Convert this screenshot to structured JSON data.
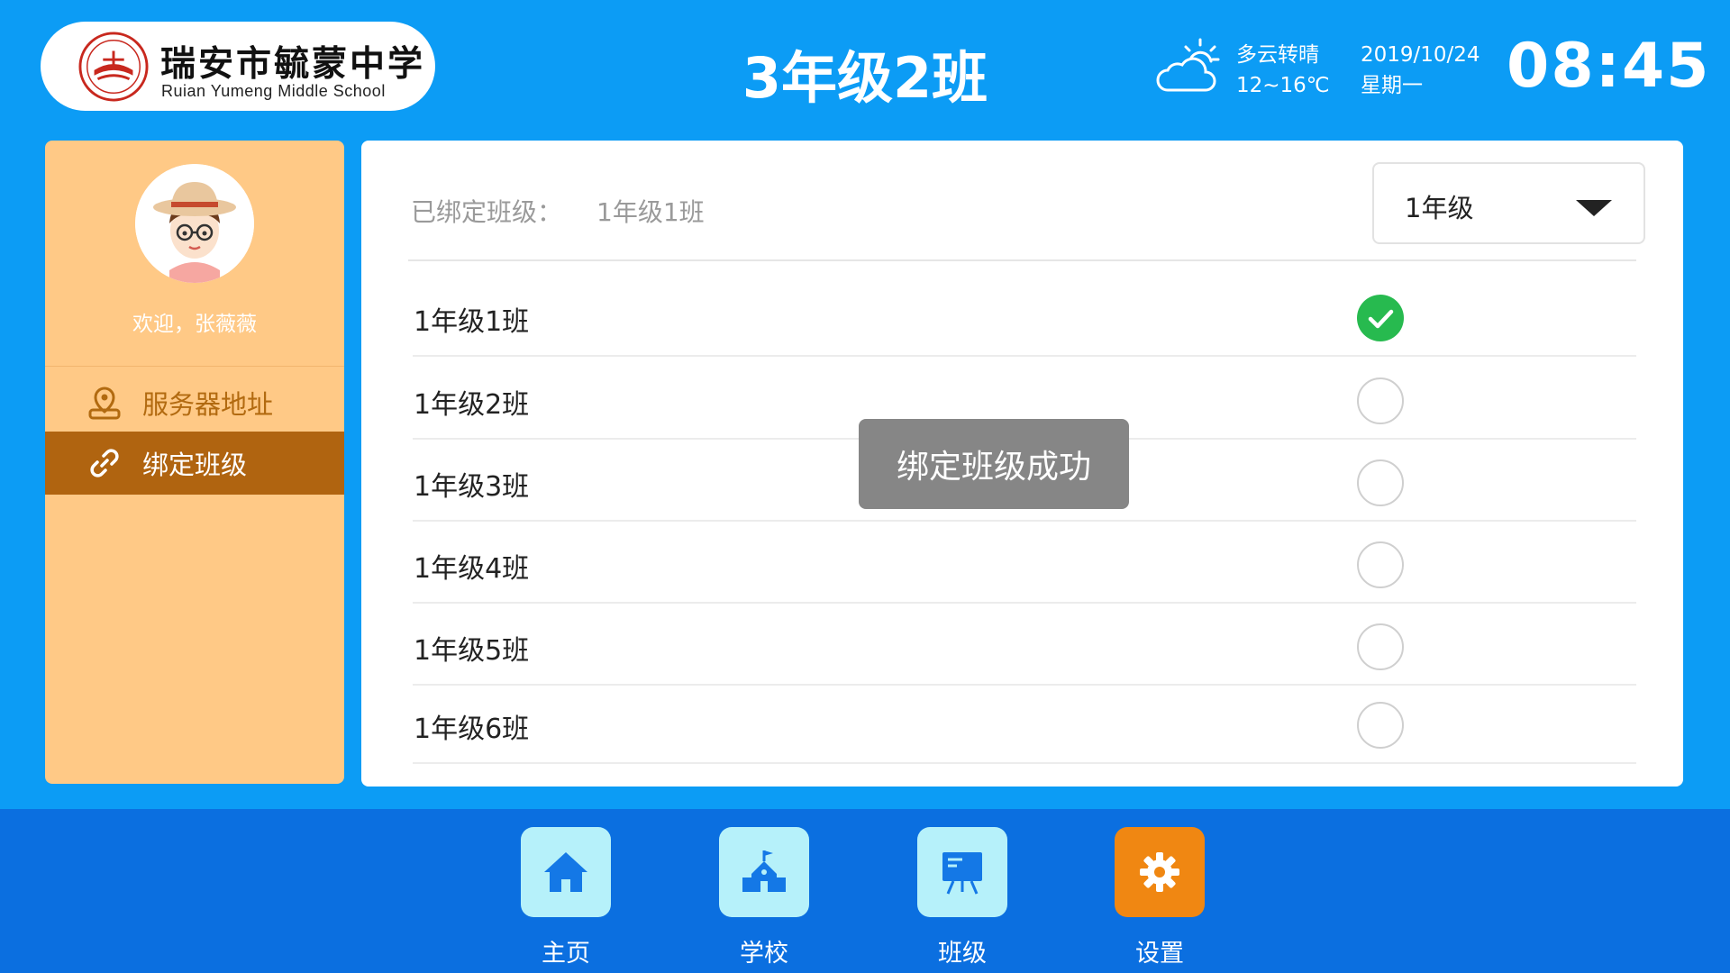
{
  "header": {
    "school_name_cn": "瑞安市毓蒙中学",
    "school_name_en": "Ruian Yumeng Middle School",
    "class_title": "3年级2班",
    "weather": {
      "condition": "多云转晴",
      "temperature": "12~16℃",
      "icon": "partly-cloudy-icon"
    },
    "date": "2019/10/24",
    "weekday": "星期一",
    "time": "08:45"
  },
  "sidebar": {
    "welcome": "欢迎，张薇薇",
    "items": [
      {
        "label": "服务器地址",
        "icon": "location-pin-icon",
        "active": false
      },
      {
        "label": "绑定班级",
        "icon": "link-icon",
        "active": true
      }
    ]
  },
  "main": {
    "bound_label": "已绑定班级：",
    "bound_value": "1年级1班",
    "grade_select": {
      "value": "1年级"
    },
    "classes": [
      {
        "name": "1年级1班",
        "selected": true
      },
      {
        "name": "1年级2班",
        "selected": false
      },
      {
        "name": "1年级3班",
        "selected": false
      },
      {
        "name": "1年级4班",
        "selected": false
      },
      {
        "name": "1年级5班",
        "selected": false
      },
      {
        "name": "1年级6班",
        "selected": false
      }
    ],
    "toast": "绑定班级成功"
  },
  "bottom_nav": [
    {
      "label": "主页",
      "icon": "home-icon",
      "active": false
    },
    {
      "label": "学校",
      "icon": "school-icon",
      "active": false
    },
    {
      "label": "班级",
      "icon": "classroom-board-icon",
      "active": false
    },
    {
      "label": "设置",
      "icon": "gear-icon",
      "active": true
    }
  ],
  "colors": {
    "background": "#0c9cf5",
    "sidebar": "#ffc986",
    "sidebar_active": "#b06410",
    "bottom_bar": "#0b6fe0",
    "nav_button": "#b6f1fa",
    "nav_active": "#f08712",
    "check_green": "#27ba4f"
  }
}
